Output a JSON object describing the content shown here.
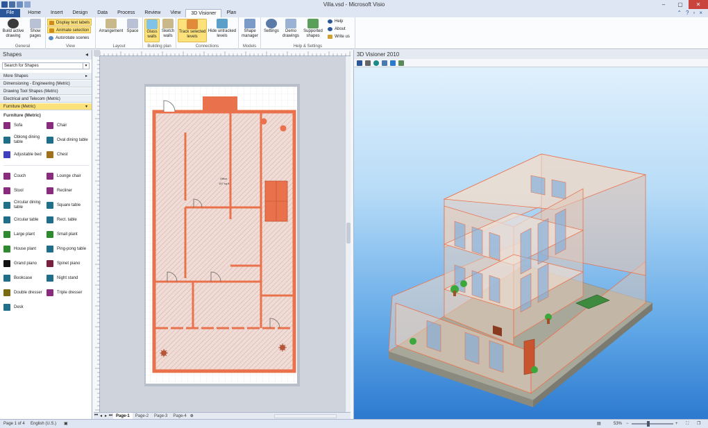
{
  "window": {
    "title": "Villa.vsd - Microsoft Visio",
    "min": "–",
    "max": "▢",
    "close": "✕"
  },
  "tabs": [
    "File",
    "Home",
    "Insert",
    "Design",
    "Data",
    "Process",
    "Review",
    "View",
    "3D Visioner",
    "Plan"
  ],
  "active_tab": "3D Visioner",
  "ribbon": {
    "general": {
      "label": "General",
      "build": "Build active drawing",
      "show_pages": "Show pages"
    },
    "view": {
      "label": "View",
      "display_text_labels": "Display text labels",
      "animate_selection": "Animate selection",
      "autorotate": "Autorotate scenes"
    },
    "layout": {
      "label": "Layout",
      "arrangement": "Arrangement",
      "space": "Space"
    },
    "building_plan": {
      "label": "Building plan",
      "glass_walls": "Glass walls",
      "sketch_walls": "Sketch walls"
    },
    "connections": {
      "label": "Connections",
      "track_selected": "Track selected levels",
      "hide_untracked": "Hide untracked levels"
    },
    "models": {
      "label": "Models",
      "shape_manager": "Shape manager"
    },
    "help_settings": {
      "label": "Help & Settings",
      "settings": "Settings",
      "demo": "Demo drawings",
      "supported": "Supported shapes",
      "help": "Help",
      "about": "About",
      "write_us": "Write us"
    }
  },
  "shapes_pane": {
    "title": "Shapes",
    "search_placeholder": "Search for Shapes",
    "stencils": [
      "More Shapes",
      "Dimensioning - Engineering (Metric)",
      "Drawing Tool Shapes (Metric)",
      "Electrical and Telecom (Metric)",
      "Furniture (Metric)"
    ],
    "selected_stencil": "Furniture (Metric)",
    "stencil_title": "Furniture (Metric)",
    "items": [
      {
        "label": "Sofa",
        "color": "#8b2b7d",
        "icon": "sofa-icon"
      },
      {
        "label": "Chair",
        "color": "#8b2b7d",
        "icon": "chair-icon"
      },
      {
        "label": "Oblong dining table",
        "color": "#1f6f8b",
        "icon": "oblong-dining-table-icon"
      },
      {
        "label": "Oval dining table",
        "color": "#1f6f8b",
        "icon": "oval-dining-table-icon"
      },
      {
        "label": "Adjustable bed",
        "color": "#3f3fbf",
        "icon": "adjustable-bed-icon"
      },
      {
        "label": "Chest",
        "color": "#a0701a",
        "icon": "chest-icon"
      },
      {
        "label": "Couch",
        "color": "#8b2b7d",
        "icon": "couch-icon"
      },
      {
        "label": "Lounge chair",
        "color": "#8b2b7d",
        "icon": "lounge-chair-icon"
      },
      {
        "label": "Stool",
        "color": "#8b2b7d",
        "icon": "stool-icon"
      },
      {
        "label": "Recliner",
        "color": "#8b2b7d",
        "icon": "recliner-icon"
      },
      {
        "label": "Circular dining table",
        "color": "#1f6f8b",
        "icon": "circular-dining-table-icon"
      },
      {
        "label": "Square table",
        "color": "#1f6f8b",
        "icon": "square-table-icon"
      },
      {
        "label": "Circular table",
        "color": "#1f6f8b",
        "icon": "circular-table-icon"
      },
      {
        "label": "Rect. table",
        "color": "#1f6f8b",
        "icon": "rect-table-icon"
      },
      {
        "label": "Large plant",
        "color": "#2f8a2f",
        "icon": "large-plant-icon"
      },
      {
        "label": "Small plant",
        "color": "#2f8a2f",
        "icon": "small-plant-icon"
      },
      {
        "label": "House plant",
        "color": "#2f8a2f",
        "icon": "house-plant-icon"
      },
      {
        "label": "Ping-pong table",
        "color": "#1f6f8b",
        "icon": "ping-pong-table-icon"
      },
      {
        "label": "Grand piano",
        "color": "#111111",
        "icon": "grand-piano-icon"
      },
      {
        "label": "Spinet piano",
        "color": "#7a1f3d",
        "icon": "spinet-piano-icon"
      },
      {
        "label": "Bookcase",
        "color": "#1f6f8b",
        "icon": "bookcase-icon"
      },
      {
        "label": "Night stand",
        "color": "#1f6f8b",
        "icon": "night-stand-icon"
      },
      {
        "label": "Double dresser",
        "color": "#7a6a10",
        "icon": "double-dresser-icon"
      },
      {
        "label": "Triple dresser",
        "color": "#8b2b7d",
        "icon": "triple-dresser-icon"
      },
      {
        "label": "Desk",
        "color": "#1f6f8b",
        "icon": "desk-icon"
      }
    ]
  },
  "drawing": {
    "room_label": "Office",
    "room_area": "157 sq.ft",
    "pages": [
      "Page-1",
      "Page-2",
      "Page-3",
      "Page-4"
    ],
    "active_page": "Page-1",
    "wall_color": "#e9724c"
  },
  "view3d": {
    "title": "3D Visioner 2010"
  },
  "status": {
    "page": "Page 1 of 4",
    "language": "English (U.S.)",
    "zoom": "53%"
  },
  "colors": {
    "accent": "#2b579a",
    "highlight": "#fde27c",
    "wall": "#e9724c",
    "sky_top": "#e0f0fd",
    "sky_bottom": "#2d79cf"
  }
}
